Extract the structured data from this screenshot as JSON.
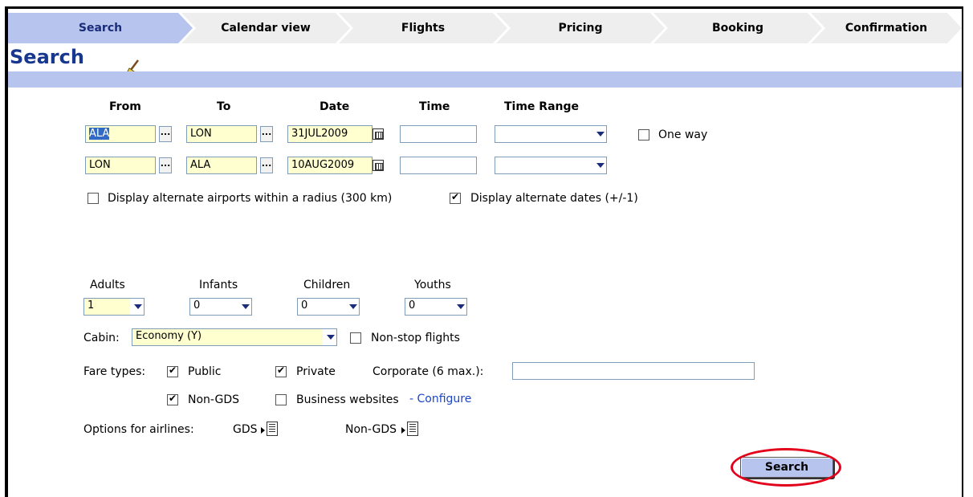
{
  "steps": [
    {
      "label": "Search"
    },
    {
      "label": "Calendar view"
    },
    {
      "label": "Flights"
    },
    {
      "label": "Pricing"
    },
    {
      "label": "Booking"
    },
    {
      "label": "Confirmation"
    }
  ],
  "title": "Search",
  "headers": {
    "from": "From",
    "to": "To",
    "date": "Date",
    "time": "Time",
    "time_range": "Time Range"
  },
  "legs": [
    {
      "from": "ALA",
      "to": "LON",
      "date": "31JUL2009",
      "time": "",
      "time_range": ""
    },
    {
      "from": "LON",
      "to": "ALA",
      "date": "10AUG2009",
      "time": "",
      "time_range": ""
    }
  ],
  "dots_label": "...",
  "one_way": {
    "label": "One way",
    "checked": false
  },
  "alternate_airports": {
    "label": "Display alternate airports within a radius (300 km)",
    "checked": false
  },
  "alternate_dates": {
    "label": "Display alternate dates (+/-1)",
    "checked": true
  },
  "passengers": {
    "adults": {
      "label": "Adults",
      "value": "1"
    },
    "infants": {
      "label": "Infants",
      "value": "0"
    },
    "children": {
      "label": "Children",
      "value": "0"
    },
    "youths": {
      "label": "Youths",
      "value": "0"
    }
  },
  "cabin": {
    "label": "Cabin:",
    "value": "Economy (Y)"
  },
  "non_stop": {
    "label": "Non-stop flights",
    "checked": false
  },
  "fare_types": {
    "label": "Fare types:",
    "public": {
      "label": "Public",
      "checked": true
    },
    "private": {
      "label": "Private",
      "checked": true
    },
    "corporate_label": "Corporate (6 max.):",
    "corporate_value": "",
    "non_gds": {
      "label": "Non-GDS",
      "checked": true
    },
    "business_websites": {
      "label": "Business websites",
      "checked": false
    },
    "configure_link": "- Configure"
  },
  "airline_options": {
    "label": "Options for airlines:",
    "gds": "GDS",
    "non_gds": "Non-GDS"
  },
  "search_button": "Search",
  "colors": {
    "accent": "#b6c4ee",
    "title": "#18378f",
    "field_bg": "#ffffd0",
    "highlight_ring": "#e2001a"
  }
}
